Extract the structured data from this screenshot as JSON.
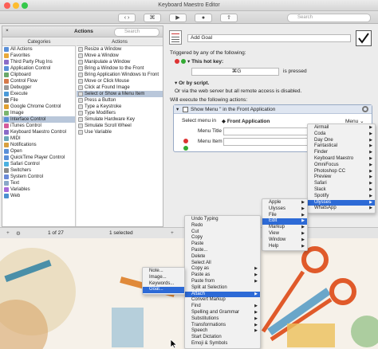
{
  "window": {
    "title": "Keyboard Maestro Editor",
    "search_placeholder": "Search",
    "palette_search_placeholder": "Search"
  },
  "palette": {
    "title": "Actions",
    "categories_header": "Categories",
    "actions_header": "Actions",
    "categories": [
      "All Actions",
      "Favorites",
      "Third Party Plug Ins",
      "Application Control",
      "Clipboard",
      "Control Flow",
      "Debugger",
      "Execute",
      "File",
      "Google Chrome Control",
      "Image",
      "Interface Control",
      "iTunes Control",
      "Keyboard Maestro Control",
      "MIDI",
      "Notifications",
      "Open",
      "QuickTime Player Control",
      "Safari Control",
      "Switchers",
      "System Control",
      "Text",
      "Variables",
      "Web"
    ],
    "selected_category": 11,
    "actions": [
      "Resize a Window",
      "Move a Window",
      "Manipulate a Window",
      "Bring a Window to the Front",
      "Bring Application Windows to Front",
      "Move or Click Mouse",
      "Click at Found Image",
      "Select or Show a Menu Item",
      "Press a Button",
      "Type a Keystroke",
      "Type Modifiers",
      "Simulate Hardware Key",
      "Simulate Scroll Wheel",
      "Use Variable"
    ],
    "selected_action": 7
  },
  "macro": {
    "name": "Add Goal",
    "triggered_label": "Triggered by any of the following:",
    "hotkey_label": "This hot key:",
    "hotkey_value": "⌘G",
    "hotkey_state": "is pressed",
    "script_label": "Or by script.",
    "webserver_label": "Or via the web server but all remote access is disabled.",
    "will_execute": "Will execute the following actions:",
    "action_title": "Show Menu \" in the Front Application",
    "select_menu_label": "Select menu in",
    "front_app": "Front Application",
    "menu_dropdown": "Menu",
    "menu_title_label": "Menu Title",
    "menu_item_label": "Menu Item"
  },
  "footer": {
    "count": "1 of 27",
    "selected": "1 selected"
  },
  "apps_menu": [
    "Airmail",
    "Coda",
    "Day One",
    "Fantastical",
    "Finder",
    "Keyboard Maestro",
    "OmniFocus",
    "Photoshop CC",
    "Preview",
    "Safari",
    "Slack",
    "Spotify",
    "Ulysses",
    "WhatsApp"
  ],
  "apps_highlight": 12,
  "ulysses_menu": [
    "Apple",
    "Ulysses",
    "File",
    "Edit",
    "Markup",
    "View",
    "Window",
    "Help"
  ],
  "ulysses_highlight": 3,
  "edit_menu": [
    "Undo Typing",
    "Redo",
    "Cut",
    "Copy",
    "Paste",
    "Paste...",
    "Delete",
    "Select All",
    "Copy as",
    "Paste as",
    "Paste from",
    "Split at Selection",
    "Attach",
    "Convert Markup",
    "Find",
    "Spelling and Grammar",
    "Substitutions",
    "Transformations",
    "Speech",
    "Start Dictation",
    "Emoji & Symbols"
  ],
  "edit_submenus": [
    8,
    9,
    10,
    12,
    14,
    15,
    16,
    17,
    18
  ],
  "edit_highlight": 12,
  "attach_menu": [
    "Note...",
    "Image...",
    "Keywords...",
    "Goal..."
  ],
  "attach_highlight": 3,
  "colors": {
    "highlight": "#2d6ad6",
    "selection": "#b9c7da"
  }
}
